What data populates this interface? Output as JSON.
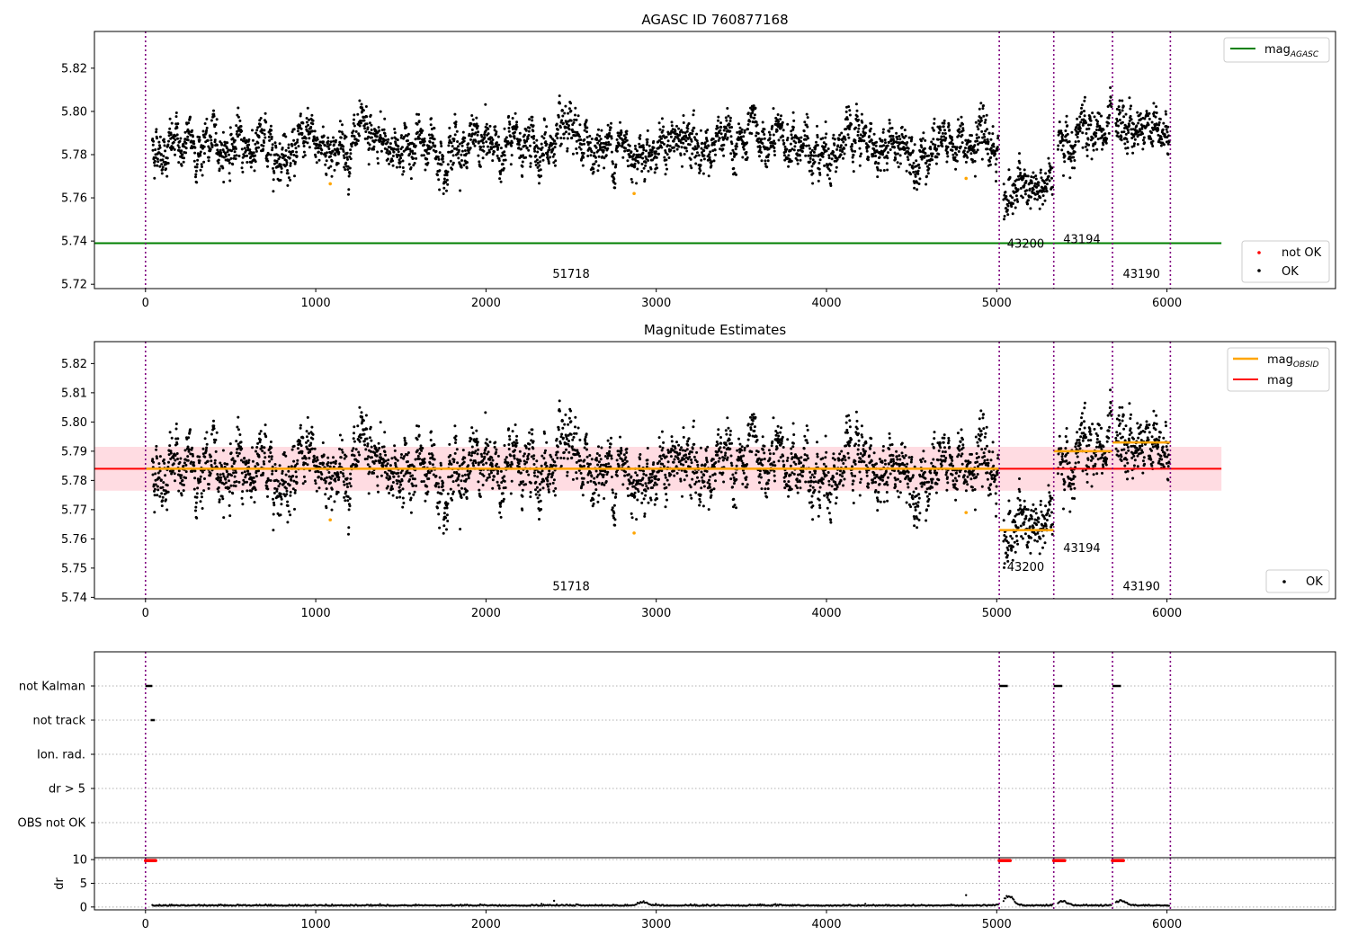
{
  "colors": {
    "ok": "#000000",
    "not_ok": "#ff0000",
    "agasc_line": "#008000",
    "obsid_mag": "#ffa500",
    "mag_line": "#ff0000",
    "band": "#ffc0cb",
    "obs_boundary": "#800080",
    "outlier": "#ffa500",
    "gridline": "#b0b0b0"
  },
  "chart_data": [
    {
      "type": "scatter",
      "title": "AGASC ID 760877168",
      "xlabel": "",
      "ylabel": "",
      "xlim": [
        -300,
        6990
      ],
      "ylim": [
        5.718,
        5.837
      ],
      "xticks": [
        "0",
        "1000",
        "2000",
        "3000",
        "4000",
        "5000",
        "6000"
      ],
      "yticks": [
        "5.72",
        "5.74",
        "5.76",
        "5.78",
        "5.80",
        "5.82"
      ],
      "grid": false,
      "legends": [
        {
          "position": "upper-right",
          "entries": [
            "mag_AGASC"
          ]
        },
        {
          "position": "lower-right",
          "entries": [
            "not OK",
            "OK"
          ]
        }
      ],
      "mag_agasc": 5.739,
      "mag_agasc_x_range": [
        -300,
        6320
      ],
      "obs_boundaries_x": [
        0,
        5015,
        5335,
        5680,
        6020
      ],
      "segments": [
        {
          "obsid": "51718",
          "x_range": [
            40,
            5010
          ],
          "mean": 5.784,
          "spread": 0.0045
        },
        {
          "obsid": "43200",
          "x_range": [
            5040,
            5330
          ],
          "mean": 5.763,
          "spread": 0.0045
        },
        {
          "obsid": "43194",
          "x_range": [
            5360,
            5675
          ],
          "mean": 5.79,
          "spread": 0.0045
        },
        {
          "obsid": "43190",
          "x_range": [
            5700,
            6015
          ],
          "mean": 5.793,
          "spread": 0.0045
        }
      ],
      "obsid_labels": [
        {
          "text": "51718",
          "x": 2500,
          "y": 5.723
        },
        {
          "text": "43200",
          "x": 5170,
          "y": 5.737
        },
        {
          "text": "43194",
          "x": 5500,
          "y": 5.739
        },
        {
          "text": "43190",
          "x": 5850,
          "y": 5.723
        }
      ],
      "outliers": [
        {
          "x": 1085,
          "y": 5.7665
        },
        {
          "x": 2870,
          "y": 5.762
        },
        {
          "x": 4820,
          "y": 5.769
        }
      ]
    },
    {
      "type": "scatter",
      "title": "Magnitude Estimates",
      "xlabel": "",
      "ylabel": "",
      "xlim": [
        -300,
        6990
      ],
      "ylim": [
        5.7395,
        5.8275
      ],
      "xticks": [
        "0",
        "1000",
        "2000",
        "3000",
        "4000",
        "5000",
        "6000"
      ],
      "yticks": [
        "5.74",
        "5.75",
        "5.76",
        "5.77",
        "5.78",
        "5.79",
        "5.80",
        "5.81",
        "5.82"
      ],
      "grid": false,
      "legends": [
        {
          "position": "upper-right",
          "entries": [
            "mag_OBSID",
            "mag"
          ]
        },
        {
          "position": "lower-right",
          "entries": [
            "OK"
          ]
        }
      ],
      "mag": 5.784,
      "mag_x_range": [
        -300,
        6320
      ],
      "band": [
        5.7765,
        5.7915
      ],
      "obsid_mags": [
        {
          "x_range": [
            0,
            5015
          ],
          "y": 5.784
        },
        {
          "x_range": [
            5015,
            5335
          ],
          "y": 5.763
        },
        {
          "x_range": [
            5335,
            5680
          ],
          "y": 5.79
        },
        {
          "x_range": [
            5680,
            6020
          ],
          "y": 5.793
        }
      ],
      "obsid_labels": [
        {
          "text": "51718",
          "x": 2500,
          "y": 5.7425
        },
        {
          "text": "43200",
          "x": 5170,
          "y": 5.749
        },
        {
          "text": "43194",
          "x": 5500,
          "y": 5.7555
        },
        {
          "text": "43190",
          "x": 5850,
          "y": 5.7425
        }
      ]
    },
    {
      "type": "scatter",
      "title": "",
      "xlabel": "",
      "ylabel": "",
      "xlim": [
        -300,
        6990
      ],
      "categories": [
        "not Kalman",
        "not track",
        "Ion. rad.",
        "dr > 5",
        "OBS not OK"
      ],
      "grid": "horizontal dotted",
      "flag_runs": [
        {
          "category": "not Kalman",
          "x_range": [
            0,
            40
          ]
        },
        {
          "category": "not Kalman",
          "x_range": [
            5015,
            5065
          ]
        },
        {
          "category": "not Kalman",
          "x_range": [
            5335,
            5385
          ]
        },
        {
          "category": "not Kalman",
          "x_range": [
            5680,
            5730
          ]
        },
        {
          "category": "not track",
          "x_range": [
            30,
            55
          ]
        }
      ]
    },
    {
      "type": "scatter",
      "title": "",
      "xlabel": "",
      "ylabel": "dr",
      "xlim": [
        -300,
        6990
      ],
      "ylim": [
        -0.6,
        10.4
      ],
      "xticks": [
        "0",
        "1000",
        "2000",
        "3000",
        "4000",
        "5000",
        "6000"
      ],
      "yticks": [
        "0",
        "5",
        "10"
      ],
      "grid": "horizontal dotted",
      "clipped_runs": [
        {
          "x_range": [
            0,
            60
          ],
          "y": 9.8
        },
        {
          "x_range": [
            5015,
            5080
          ],
          "y": 9.8
        },
        {
          "x_range": [
            5335,
            5400
          ],
          "y": 9.8
        },
        {
          "x_range": [
            5680,
            5745
          ],
          "y": 9.8
        }
      ],
      "bumps": [
        {
          "x": 5070,
          "peak": 2.2
        },
        {
          "x": 5385,
          "peak": 1.1
        },
        {
          "x": 5730,
          "peak": 1.3
        },
        {
          "x": 2920,
          "peak": 0.8
        }
      ],
      "outliers": [
        {
          "x": 2400,
          "y": 1.3
        },
        {
          "x": 4820,
          "y": 2.5
        }
      ]
    }
  ],
  "legend_text": {
    "mag_main": "mag",
    "agasc_sub": "AGASC",
    "obsid_sub": "OBSID",
    "mag": "mag",
    "not_ok": "not OK",
    "ok": "OK"
  }
}
